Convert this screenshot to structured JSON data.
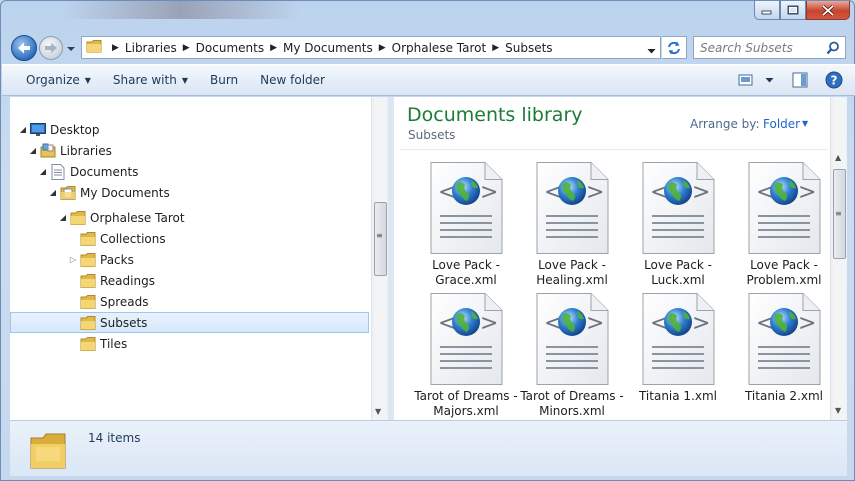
{
  "window": {
    "caption_buttons": [
      "minimize-icon",
      "maximize-icon",
      "close-icon"
    ]
  },
  "address": {
    "crumbs": [
      "Libraries",
      "Documents",
      "My Documents",
      "Orphalese Tarot",
      "Subsets"
    ]
  },
  "search": {
    "placeholder": "Search Subsets"
  },
  "toolbar": {
    "organize": "Organize",
    "share_with": "Share with",
    "burn": "Burn",
    "new_folder": "New folder"
  },
  "nav": {
    "items": [
      {
        "label": "Desktop",
        "icon": "desktop-icon"
      },
      {
        "label": "Libraries",
        "icon": "libraries-icon"
      },
      {
        "label": "Documents",
        "icon": "documents-icon"
      },
      {
        "label": "My Documents",
        "icon": "documents-folder-icon"
      },
      {
        "label": "Orphalese Tarot",
        "icon": "folder-icon"
      },
      {
        "label": "Collections",
        "icon": "folder-icon"
      },
      {
        "label": "Packs",
        "icon": "folder-icon"
      },
      {
        "label": "Readings",
        "icon": "folder-icon"
      },
      {
        "label": "Spreads",
        "icon": "folder-icon"
      },
      {
        "label": "Subsets",
        "icon": "folder-icon",
        "selected": true
      },
      {
        "label": "Tiles",
        "icon": "folder-icon"
      }
    ]
  },
  "library": {
    "title": "Documents library",
    "subtitle": "Subsets",
    "arrange_label": "Arrange by:",
    "arrange_value": "Folder"
  },
  "files": [
    {
      "line1": "Love Pack -",
      "line2": "Grace.xml"
    },
    {
      "line1": "Love Pack -",
      "line2": "Healing.xml"
    },
    {
      "line1": "Love Pack -",
      "line2": "Luck.xml"
    },
    {
      "line1": "Love Pack -",
      "line2": "Problem.xml"
    },
    {
      "line1": "Tarot of Dreams -",
      "line2": "Majors.xml"
    },
    {
      "line1": "Tarot of Dreams -",
      "line2": "Minors.xml"
    },
    {
      "line1": "Titania 1.xml",
      "line2": ""
    },
    {
      "line1": "Titania 2.xml",
      "line2": ""
    }
  ],
  "status": {
    "count": "14 items"
  },
  "colors": {
    "accent_green": "#1b7c35",
    "link_blue": "#1e66c8",
    "selection": "#d6e8fb"
  }
}
